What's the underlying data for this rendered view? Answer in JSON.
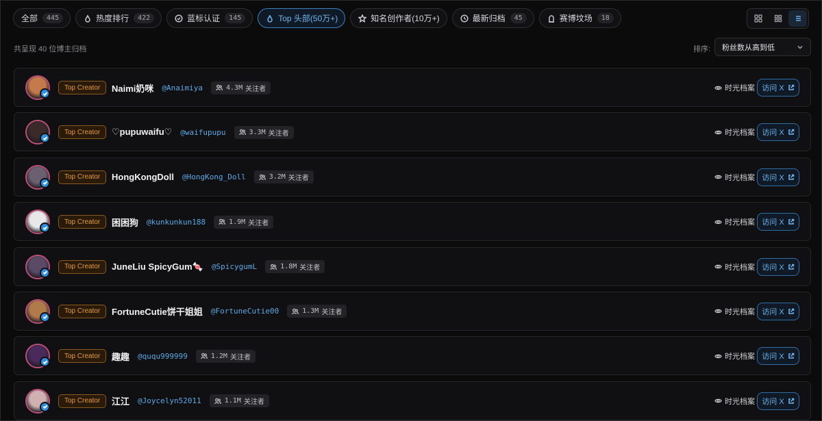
{
  "tabs": [
    {
      "label": "全部",
      "count": "445",
      "icon": "none",
      "active": false
    },
    {
      "label": "热度排行",
      "count": "422",
      "icon": "flame-icon",
      "active": false
    },
    {
      "label": "蓝标认证",
      "count": "145",
      "icon": "check-circle-icon",
      "active": false
    },
    {
      "label": "Top 头部(50万+)",
      "count": "",
      "icon": "flame-icon",
      "active": true
    },
    {
      "label": "知名创作者(10万+)",
      "count": "",
      "icon": "star-icon",
      "active": false
    },
    {
      "label": "最新归档",
      "count": "45",
      "icon": "clock-icon",
      "active": false
    },
    {
      "label": "赛博坟场",
      "count": "18",
      "icon": "tombstone-icon",
      "active": false
    }
  ],
  "view_modes": [
    "large-grid-icon",
    "grid-icon",
    "list-icon"
  ],
  "active_view": "list-icon",
  "summary": "共呈现 40 位博主归档",
  "sort": {
    "label": "排序:",
    "value": "粉丝数从高到低"
  },
  "row_labels": {
    "badge": "Top Creator",
    "followers_suffix": "关注者",
    "archive": "时光档案",
    "visit": "访问 X"
  },
  "creators": [
    {
      "name": "Naimi奶咪",
      "handle": "@Anaimiya",
      "followers": "4.3M",
      "avatar_color": "#c47a4a"
    },
    {
      "name": "♡pupuwaifu♡",
      "handle": "@waifupupu",
      "followers": "3.3M",
      "avatar_color": "#3a2a2a"
    },
    {
      "name": "HongKongDoll",
      "handle": "@HongKong_Doll",
      "followers": "3.2M",
      "avatar_color": "#6a6070"
    },
    {
      "name": "困困狗",
      "handle": "@kunkunkun188",
      "followers": "1.9M",
      "avatar_color": "#e8e8e8"
    },
    {
      "name": "JuneLiu SpicyGum🍬",
      "handle": "@SpicygumL",
      "followers": "1.8M",
      "avatar_color": "#5a4a66"
    },
    {
      "name": "FortuneCutie饼干姐姐",
      "handle": "@FortuneCutie00",
      "followers": "1.3M",
      "avatar_color": "#b07a4a"
    },
    {
      "name": "趣趣",
      "handle": "@ququ999999",
      "followers": "1.2M",
      "avatar_color": "#4a2a5a"
    },
    {
      "name": "江江",
      "handle": "@Joycelyn52011",
      "followers": "1.1M",
      "avatar_color": "#d0b0b0"
    }
  ],
  "colors": {
    "accent": "#6fb6f0",
    "badge": "#e59a3c",
    "verify": "#2f8fe0",
    "avatar_ring": "#c0507a"
  }
}
